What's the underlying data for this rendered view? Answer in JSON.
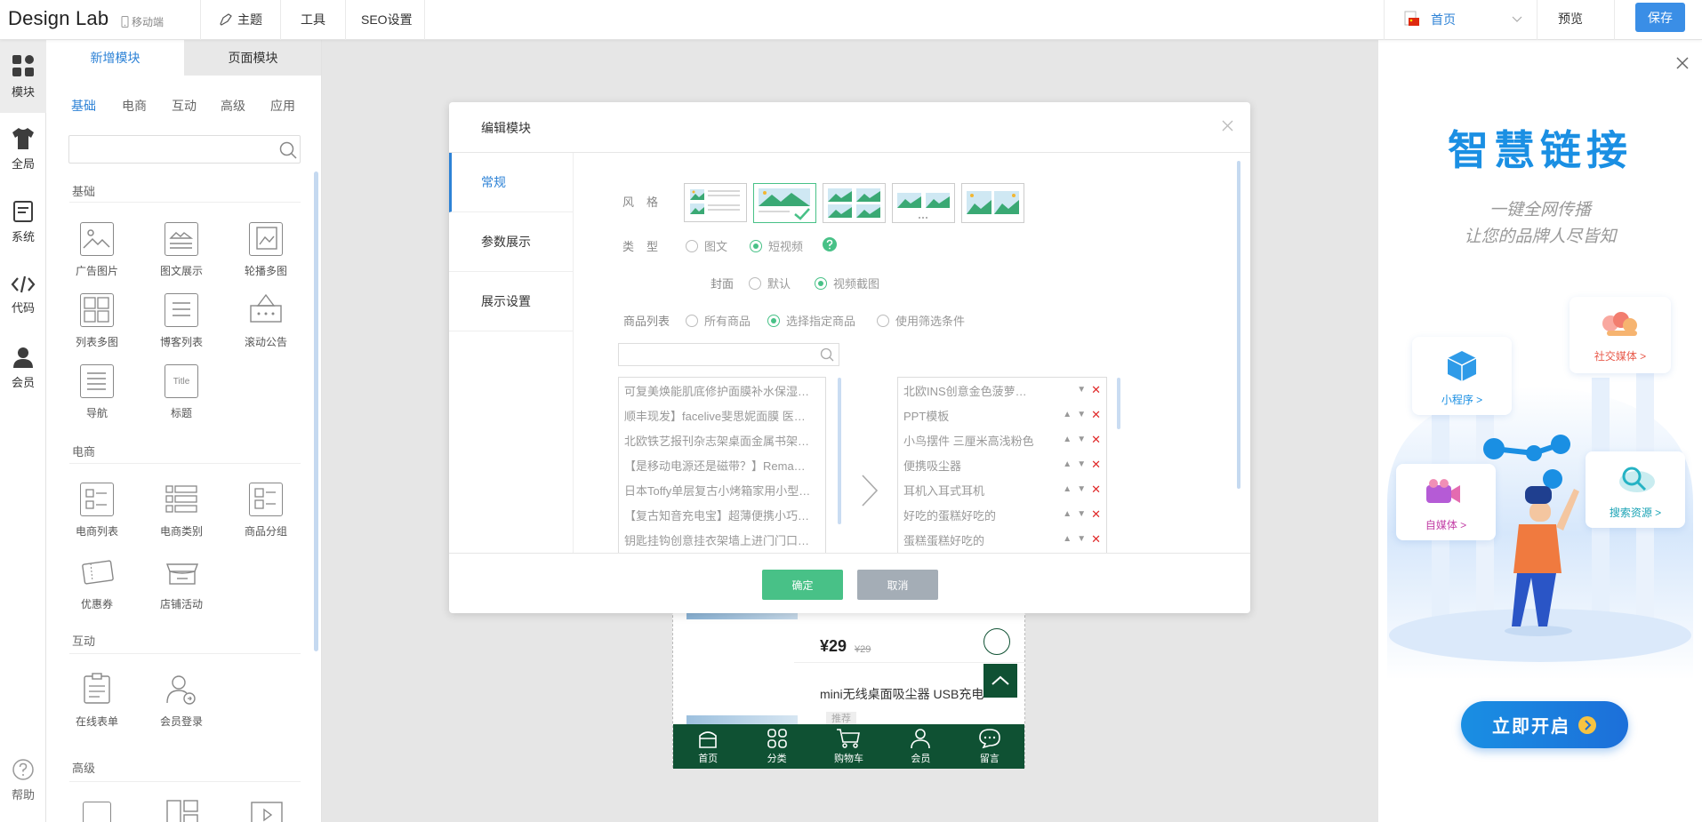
{
  "topbar": {
    "logo": "Design Lab",
    "mobile_label": "移动端",
    "menus": [
      "主题",
      "工具",
      "SEO设置"
    ],
    "page_select": "首页",
    "preview": "预览",
    "save": "保存"
  },
  "rail": {
    "items": [
      "模块",
      "全局",
      "系统",
      "代码",
      "会员"
    ],
    "help": "帮助"
  },
  "panel": {
    "tabs": [
      "新增模块",
      "页面模块"
    ],
    "subtabs": [
      "基础",
      "电商",
      "互动",
      "高级",
      "应用"
    ],
    "sections": {
      "basic": "基础",
      "ecommerce": "电商",
      "interactive": "互动",
      "advanced": "高级"
    },
    "basic_modules": [
      "广告图片",
      "图文展示",
      "轮播多图",
      "列表多图",
      "博客列表",
      "滚动公告",
      "导航",
      "标题"
    ],
    "ecom_modules": [
      "电商列表",
      "电商类别",
      "商品分组",
      "优惠券",
      "店铺活动"
    ],
    "interactive_modules": [
      "在线表单",
      "会员登录"
    ],
    "title_icon_text": "Title"
  },
  "modal": {
    "title": "编辑模块",
    "tabs": [
      "常规",
      "参数展示",
      "展示设置"
    ],
    "style_label": "风格",
    "type_label": "类型",
    "type_options": [
      "图文",
      "短视频"
    ],
    "cover_label": "封面",
    "cover_options": [
      "默认",
      "视频截图"
    ],
    "goods_label": "商品列表",
    "goods_options": [
      "所有商品",
      "选择指定商品",
      "使用筛选条件"
    ],
    "left_list": [
      "可复美焕能肌底修护面膜补水保湿…",
      "顺丰现发】facelive斐思妮面膜 医…",
      "北欧铁艺报刊杂志架桌面金属书架…",
      "【是移动电源还是磁带？】Rema…",
      "日本Toffy单层复古小烤箱家用小型…",
      "【复古知音充电宝】超薄便携小巧…",
      "钥匙挂钩创意挂衣架墙上进门门口…"
    ],
    "right_list": [
      "北欧INS创意金色菠萝…",
      "PPT模板",
      "小鸟摆件 三厘米高浅粉色",
      "便携吸尘器",
      "耳机入耳式耳机",
      "好吃的蛋糕好吃的",
      "蛋糕蛋糕好吃的"
    ],
    "ok": "确定",
    "cancel": "取消"
  },
  "phone": {
    "price": "¥29",
    "old_price": "¥29",
    "product_name": "mini无线桌面吸尘器 USB充电",
    "tag": "推荐",
    "nav": [
      "首页",
      "分类",
      "购物车",
      "会员",
      "留言"
    ]
  },
  "promo": {
    "title": "智慧链接",
    "line1": "一键全网传播",
    "line2": "让您的品牌人尽皆知",
    "social": "社交媒体 >",
    "miniprogram": "小程序 >",
    "selfmedia": "自媒体 >",
    "search": "搜索资源 >",
    "cta": "立即开启"
  },
  "colors": {
    "accent": "#2d82d6",
    "save": "#3a8ee6",
    "ok": "#48c187",
    "cancel": "#a4adb6",
    "phone_nav": "#0f5133",
    "delete": "#e02a2a"
  }
}
